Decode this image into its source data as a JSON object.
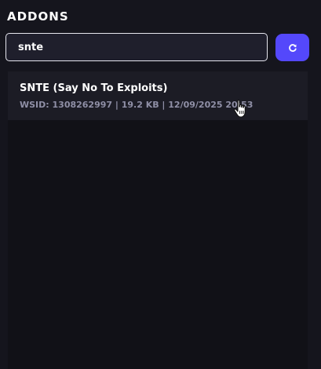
{
  "panel": {
    "title": "ADDONS"
  },
  "search": {
    "value": "snte",
    "placeholder": ""
  },
  "refresh_button": {
    "icon": "refresh-icon",
    "glyph": "↻"
  },
  "results": [
    {
      "name": "SNTE (Say No To Exploits)",
      "meta": "WSID: 1308262997 | 19.2 KB | 12/09/2025 20:53"
    }
  ],
  "colors": {
    "background": "#15151d",
    "accent": "#5448fb",
    "item_background": "#1c1c25",
    "meta_text": "#8f8fa6"
  }
}
